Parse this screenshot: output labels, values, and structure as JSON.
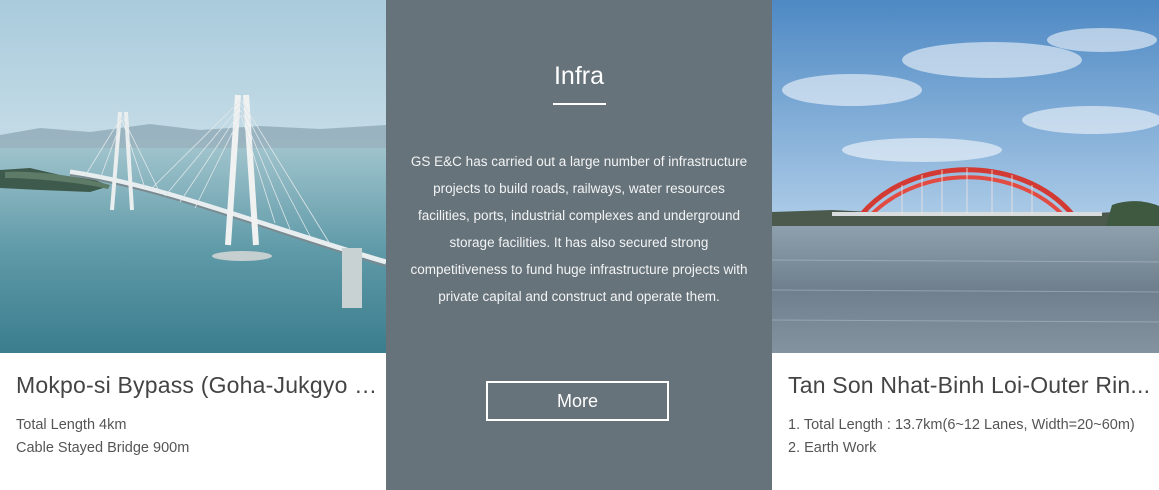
{
  "left_card": {
    "title": "Mokpo-si Bypass (Goha-Jukgyo C...",
    "details": [
      "Total Length 4km",
      "Cable Stayed Bridge 900m"
    ],
    "image_icon": "cable-stayed-bridge-photo"
  },
  "center_panel": {
    "heading": "Infra",
    "description": "GS E&C has carried out a large number of infrastructure projects to build roads, railways, water resources facilities, ports, industrial complexes and underground storage facilities. It has also secured strong competitiveness to fund huge infrastructure projects with private capital and construct and operate them.",
    "more_label": "More",
    "background_color": "#67737a"
  },
  "right_card": {
    "title": "Tan Son Nhat-Binh Loi-Outer Rin...",
    "details": [
      "1. Total Length : 13.7km(6~12 Lanes, Width=20~60m)",
      "2. Earth Work"
    ],
    "image_icon": "arch-bridge-photo"
  }
}
